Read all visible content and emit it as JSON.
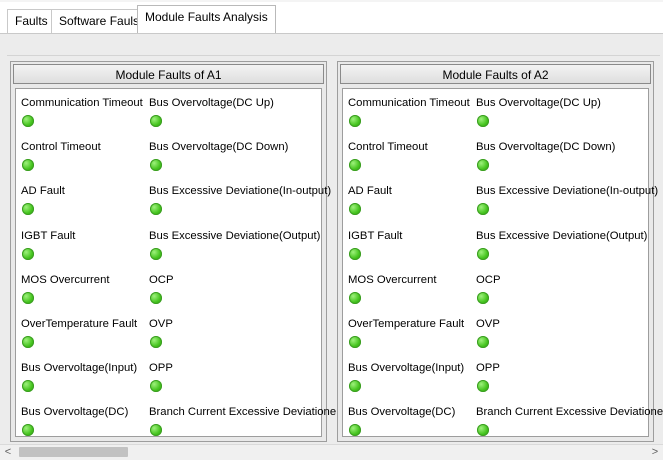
{
  "tabs": [
    {
      "label": "Faults"
    },
    {
      "label": "Software Fauls"
    },
    {
      "label": "Module Faults Analysis",
      "active": true
    }
  ],
  "groups": [
    {
      "title": "Module Faults of A1"
    },
    {
      "title": "Module Faults of A2"
    }
  ],
  "faults_left": [
    "Communication Timeout",
    "Control Timeout",
    "AD Fault",
    "IGBT Fault",
    "MOS Overcurrent",
    "OverTemperature Fault",
    "Bus Overvoltage(Input)",
    "Bus Overvoltage(DC)"
  ],
  "faults_right": [
    "Bus Overvoltage(DC Up)",
    "Bus Overvoltage(DC Down)",
    "Bus Excessive Deviatione(In-output)",
    "Bus Excessive Deviatione(Output)",
    "OCP",
    "OVP",
    "OPP",
    "Branch Current Excessive Deviatione"
  ],
  "led_color": "#45c41e",
  "scrollbar": {
    "left_icon": "chevron-left-icon",
    "right_icon": "chevron-right-icon",
    "left_glyph": "<",
    "right_glyph": ">"
  }
}
